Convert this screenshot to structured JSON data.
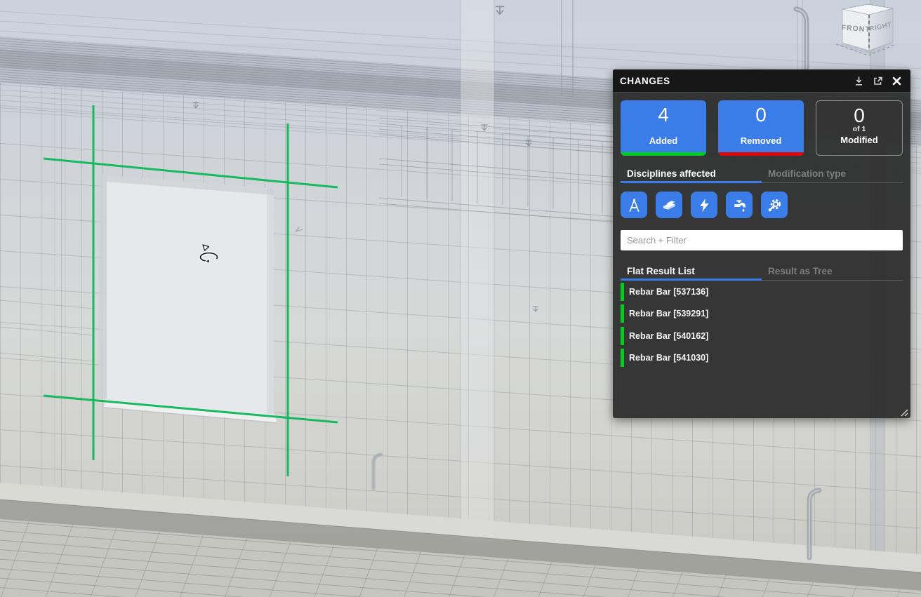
{
  "viewer": {
    "view_cube": {
      "front": "FRONT",
      "right": "RIGHT"
    },
    "highlight_color": "#17b95f",
    "cursor": "orbit",
    "highlighted_elements": 4
  },
  "panel": {
    "title": "CHANGES",
    "header_icons": [
      "download",
      "open-external",
      "close"
    ],
    "accent_blue": "#3b7de8",
    "cards": [
      {
        "value": "4",
        "label": "Added",
        "accent": "#00cc22",
        "style": "blue"
      },
      {
        "value": "0",
        "label": "Removed",
        "accent": "#e60505",
        "style": "blue"
      },
      {
        "value": "0",
        "sub": "of 1",
        "label": "Modified",
        "style": "outline"
      }
    ],
    "filter_tabs": [
      {
        "label": "Disciplines affected",
        "active": true
      },
      {
        "label": "Modification type",
        "active": false
      }
    ],
    "disciplines": [
      "architecture",
      "structural",
      "electrical",
      "plumbing",
      "mechanical"
    ],
    "search": {
      "placeholder": "Search + Filter",
      "value": ""
    },
    "result_tabs": [
      {
        "label": "Flat Result List",
        "active": true
      },
      {
        "label": "Result as Tree",
        "active": false
      }
    ],
    "results": [
      {
        "label": "Rebar Bar [537136]",
        "status_color": "#00cc22"
      },
      {
        "label": "Rebar Bar [539291]",
        "status_color": "#00cc22"
      },
      {
        "label": "Rebar Bar [540162]",
        "status_color": "#00cc22"
      },
      {
        "label": "Rebar Bar [541030]",
        "status_color": "#00cc22"
      }
    ]
  }
}
